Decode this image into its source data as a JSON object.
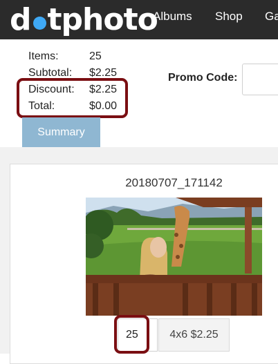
{
  "navbar": {
    "logo_first": "d",
    "logo_rest": "tphoto",
    "links": [
      "Albums",
      "Shop",
      "Ga"
    ]
  },
  "summary": {
    "items_label": "Items:",
    "items_value": "25",
    "subtotal_label": "Subtotal:",
    "subtotal_value": "$2.25",
    "discount_label": "Discount:",
    "discount_value": "$2.25",
    "total_label": "Total:",
    "total_value": "$0.00",
    "button_label": "Summary"
  },
  "promo": {
    "label": "Promo Code:",
    "value": ""
  },
  "photo": {
    "title": "20180707_171142",
    "quantity": "25",
    "size_option": "4x6 $2.25"
  },
  "colors": {
    "navbar_bg": "#2b2b2b",
    "logo_dot": "#3fa9f5",
    "summary_button": "#8fb7d2",
    "highlight": "#7a0e12"
  }
}
